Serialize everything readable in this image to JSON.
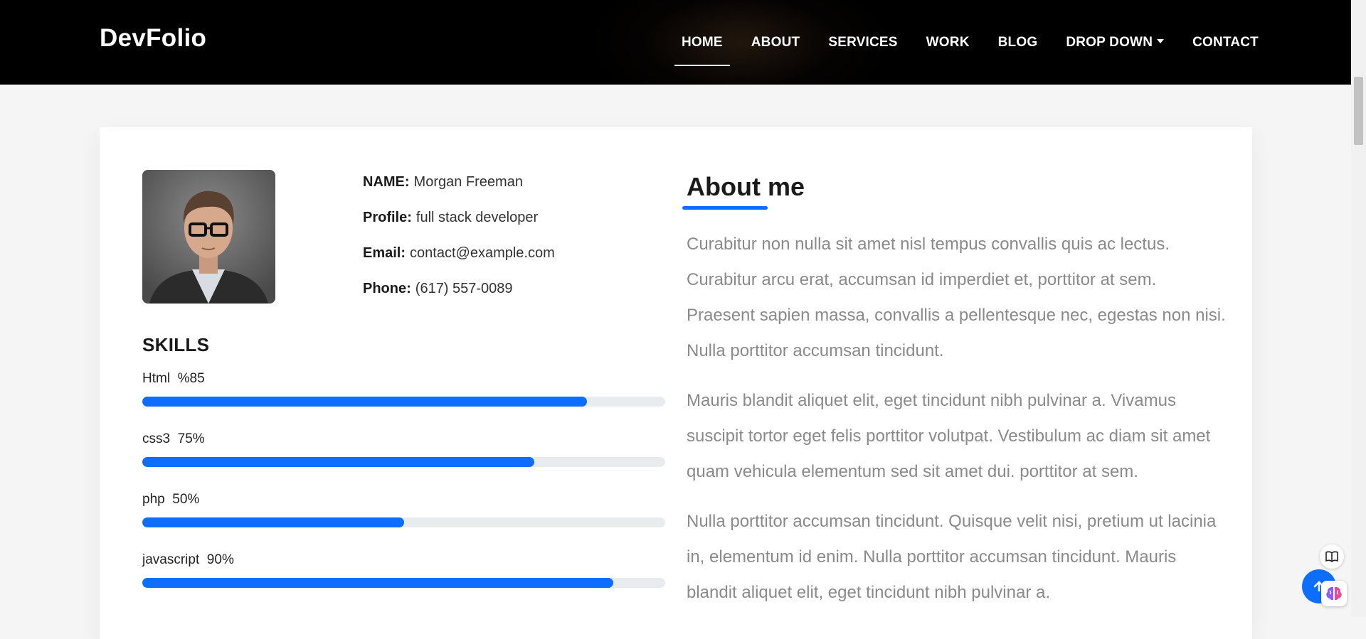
{
  "header": {
    "brand": "DevFolio",
    "nav": [
      {
        "label": "HOME",
        "active": true
      },
      {
        "label": "ABOUT"
      },
      {
        "label": "SERVICES"
      },
      {
        "label": "WORK"
      },
      {
        "label": "BLOG"
      },
      {
        "label": "DROP DOWN",
        "has_dropdown": true
      },
      {
        "label": "CONTACT"
      }
    ]
  },
  "profile": {
    "name_label": "NAME:",
    "name": "Morgan Freeman",
    "profile_label": "Profile:",
    "profile": "full stack developer",
    "email_label": "Email:",
    "email": "contact@example.com",
    "phone_label": "Phone:",
    "phone": "(617) 557-0089"
  },
  "skills": {
    "title": "SKILLS",
    "items": [
      {
        "label": "Html  %85",
        "percent": 85
      },
      {
        "label": "css3  75%",
        "percent": 75
      },
      {
        "label": "php  50%",
        "percent": 50
      },
      {
        "label": "javascript  90%",
        "percent": 90
      }
    ]
  },
  "about": {
    "title": "About me",
    "paragraphs": [
      "Curabitur non nulla sit amet nisl tempus convallis quis ac lectus. Curabitur arcu erat, accumsan id imperdiet et, porttitor at sem. Praesent sapien massa, convallis a pellentesque nec, egestas non nisi. Nulla porttitor accumsan tincidunt.",
      "Mauris blandit aliquet elit, eget tincidunt nibh pulvinar a. Vivamus suscipit tortor eget felis porttitor volutpat. Vestibulum ac diam sit amet quam vehicula elementum sed sit amet dui. porttitor at sem.",
      "Nulla porttitor accumsan tincidunt. Quisque velit nisi, pretium ut lacinia in, elementum id enim. Nulla porttitor accumsan tincidunt. Mauris blandit aliquet elit, eget tincidunt nibh pulvinar a."
    ]
  },
  "colors": {
    "accent": "#0d6efd",
    "header_bg": "#000000",
    "page_bg": "#f5f5f5"
  },
  "icons": {
    "reader": "book-icon",
    "back_to_top": "arrow-up-icon",
    "assistant": "brain-icon"
  }
}
